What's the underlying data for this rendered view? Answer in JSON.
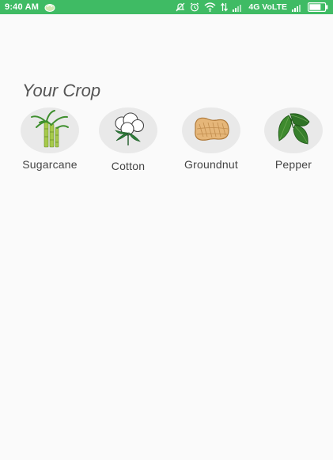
{
  "status_bar": {
    "time": "9:40 AM",
    "network_label": "4G VoLTE",
    "background": "#3fbb64",
    "icons": [
      "app-notification-icon",
      "mute-icon",
      "alarm-icon",
      "wifi-icon",
      "data-transfer-icon",
      "signal-icon",
      "signal-icon",
      "battery-icon"
    ]
  },
  "section": {
    "title": "Your Crop"
  },
  "crops": [
    {
      "label": "Sugarcane",
      "icon": "sugarcane-icon"
    },
    {
      "label": "Cotton",
      "icon": "cotton-icon"
    },
    {
      "label": "Groundnut",
      "icon": "groundnut-icon"
    },
    {
      "label": "Pepper",
      "icon": "pepper-icon"
    }
  ]
}
